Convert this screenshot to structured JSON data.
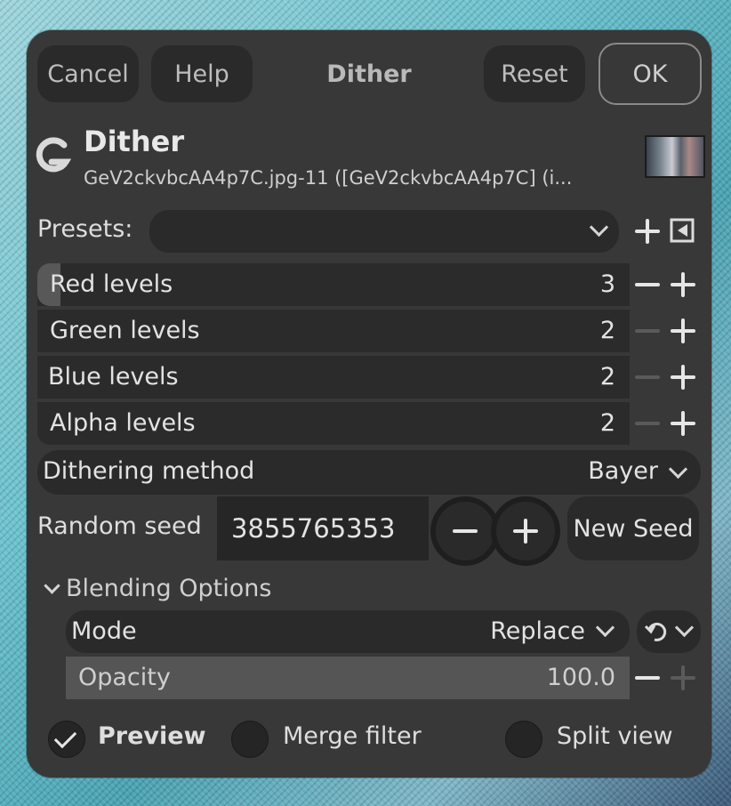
{
  "header": {
    "cancel": "Cancel",
    "help": "Help",
    "title": "Dither",
    "reset": "Reset",
    "ok": "OK"
  },
  "plugin": {
    "title": "Dither",
    "subtitle": "GeV2ckvbcAA4p7C.jpg-11 ([GeV2ckvbcAA4p7C] (i..."
  },
  "presets": {
    "label": "Presets:",
    "value": ""
  },
  "levels": [
    {
      "label": "Red levels",
      "value": "3"
    },
    {
      "label": "Green levels",
      "value": "2"
    },
    {
      "label": "Blue levels",
      "value": "2"
    },
    {
      "label": "Alpha levels",
      "value": "2"
    }
  ],
  "dithering": {
    "label": "Dithering method",
    "value": "Bayer"
  },
  "seed": {
    "label": "Random seed",
    "value": "3855765353",
    "new_seed": "New Seed"
  },
  "blending": {
    "section_label": "Blending Options",
    "mode_label": "Mode",
    "mode_value": "Replace",
    "opacity_label": "Opacity",
    "opacity_value": "100.0"
  },
  "footer": {
    "preview": "Preview",
    "preview_checked": true,
    "merge": "Merge filter",
    "split": "Split view"
  },
  "icons": [
    "gimp-logo-icon",
    "chevron-down-icon",
    "plus-icon",
    "minus-icon",
    "preset-menu-icon",
    "reset-icon",
    "checkmark-icon"
  ],
  "colors": {
    "dialog_bg": "#383838",
    "field_bg": "#2a2a2a",
    "text": "#e3e3e3"
  }
}
